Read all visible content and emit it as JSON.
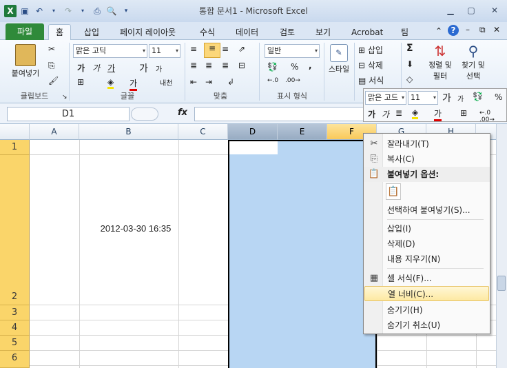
{
  "window": {
    "title": "통합 문서1 - Microsoft Excel"
  },
  "tabs": {
    "file": "파일",
    "home": "홈",
    "insert": "삽입",
    "layout": "페이지 레이아웃",
    "formula": "수식",
    "data": "데이터",
    "review": "검토",
    "view": "보기",
    "acrobat": "Acrobat",
    "team": "팀"
  },
  "ribbon": {
    "paste": "붙여넣기",
    "clipboard": "클립보드",
    "font_group": "글꼴",
    "align_group": "맞춤",
    "number_group": "표시 형식",
    "font_name": "맑은 고딕",
    "font_size": "11",
    "number_format": "일반",
    "insert": "삽입",
    "delete": "삭제",
    "format": "서식",
    "style": "스타일",
    "sort": "정렬 및",
    "filter": "필터",
    "find": "찾기 및",
    "select": "선택",
    "font_a1": "가",
    "font_a2": "가",
    "font_a3": "가",
    "font_big": "가",
    "font_small": "가",
    "font_red": "가",
    "wrap": "내천",
    "percent": "%",
    "comma": ","
  },
  "formula_bar": {
    "name_box": "D1",
    "fx": "fx"
  },
  "mini_toolbar": {
    "font": "맑은 고드",
    "size": "11",
    "big": "가",
    "small": "가",
    "percent": "%",
    "b1": "가",
    "b2": "가",
    "red": "가"
  },
  "sheet": {
    "columns": [
      "A",
      "B",
      "C",
      "D",
      "E",
      "F",
      "G",
      "H"
    ],
    "rows": [
      "1",
      "2",
      "3",
      "4",
      "5",
      "6"
    ],
    "cell_B2": "2012-03-30 16:35"
  },
  "context_menu": {
    "cut": "잘라내기(T)",
    "copy": "복사(C)",
    "paste_options": "붙여넣기 옵션:",
    "paste_special": "선택하여 붙여넣기(S)...",
    "insert": "삽입(I)",
    "delete": "삭제(D)",
    "clear": "내용 지우기(N)",
    "format_cells": "셀 서식(F)...",
    "column_width": "열 너비(C)...",
    "hide": "숨기기(H)",
    "unhide": "숨기기 취소(U)"
  },
  "colors": {
    "file_tab": "#2f8a3a",
    "row_header": "#fad56a",
    "selection": "#b8d6f3",
    "highlight": "#fde9a2"
  }
}
